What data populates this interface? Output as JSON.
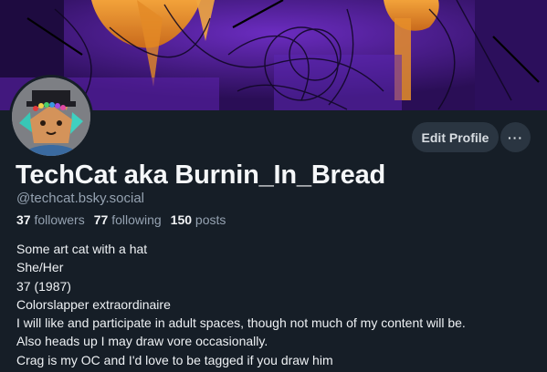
{
  "profile": {
    "display_name": "TechCat aka Burnin_In_Bread",
    "handle": "@techcat.bsky.social",
    "edit_profile_label": "Edit Profile",
    "more_label": "···",
    "stats": {
      "followers_count": "37",
      "followers_label": "followers",
      "following_count": "77",
      "following_label": "following",
      "posts_count": "150",
      "posts_label": "posts"
    },
    "bio_lines": [
      "Some art cat with a hat",
      "She/Her",
      "37 (1987)",
      "Colorslapper extraordinaire",
      "I will like and participate in adult spaces, though not much of my content will be.",
      "Also heads up I may draw vore occasionally.",
      "Crag is my OC and I'd love to be tagged if you draw him"
    ]
  },
  "colors": {
    "background": "#161e27",
    "button_bg": "#2a3541",
    "muted_text": "#95a2b1",
    "banner_purple": "#3a1478",
    "banner_orange": "#e8922e"
  },
  "icons": {
    "more": "ellipsis-icon"
  }
}
